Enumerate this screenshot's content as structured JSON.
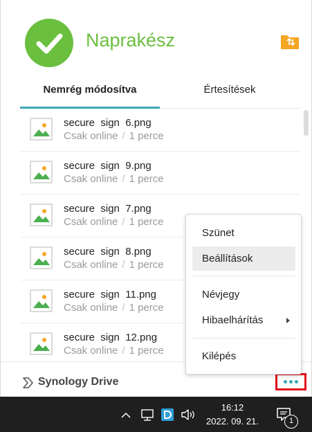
{
  "header": {
    "status_title": "Naprakész",
    "status_icon": "check-circle-icon",
    "status_color": "#6bbf3f",
    "action_icon": "folder-sync-icon",
    "action_color": "#f5a623"
  },
  "tabs": [
    {
      "label": "Nemrég módosítva",
      "active": true
    },
    {
      "label": "Értesítések",
      "active": false
    }
  ],
  "accent_color": "#3aa7b5",
  "files": [
    {
      "name": "secure  sign  6.png",
      "status": "Csak online",
      "time": "1 perce"
    },
    {
      "name": "secure  sign  9.png",
      "status": "Csak online",
      "time": "1 perce"
    },
    {
      "name": "secure  sign  7.png",
      "status": "Csak online",
      "time": "1 perce"
    },
    {
      "name": "secure  sign  8.png",
      "status": "Csak online",
      "time": "1 perce"
    },
    {
      "name": "secure  sign  11.png",
      "status": "Csak online",
      "time": "1 perce"
    },
    {
      "name": "secure  sign  12.png",
      "status": "Csak online",
      "time": "1 perce"
    }
  ],
  "footer": {
    "brand": "Synology Drive",
    "more_icon": "more-dots-icon"
  },
  "menu": {
    "items": [
      {
        "label": "Szünet"
      },
      {
        "label": "Beállítások",
        "hovered": true
      },
      {
        "label": "Névjegy"
      },
      {
        "label": "Hibaelhárítás",
        "submenu": true
      },
      {
        "label": "Kilépés"
      }
    ]
  },
  "taskbar": {
    "time": "16:12",
    "date": "2022. 09. 21.",
    "notification_count": "1"
  }
}
